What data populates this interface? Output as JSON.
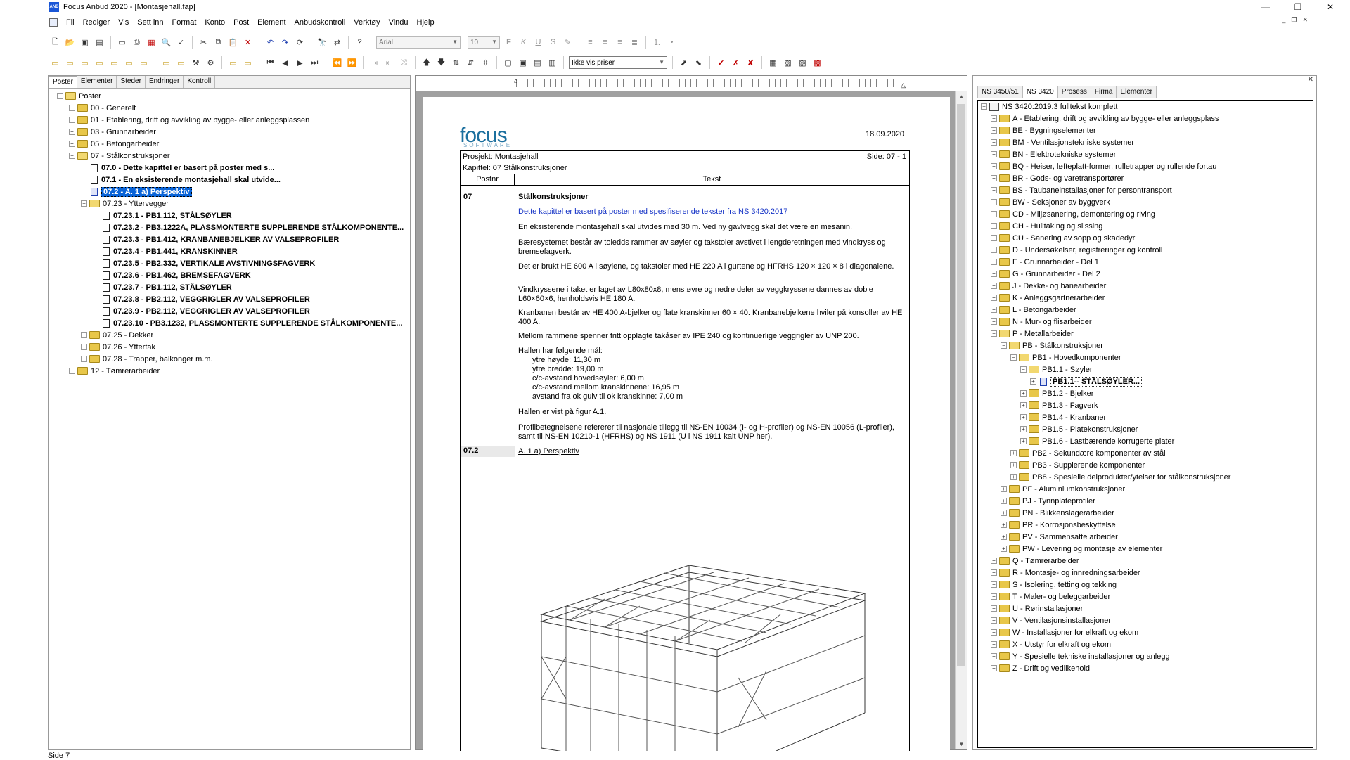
{
  "window": {
    "title": "Focus Anbud 2020 - [Montasjehall.fap]",
    "app_icon": "ANB"
  },
  "window_controls": [
    "minimize-icon",
    "restore-icon",
    "close-icon"
  ],
  "menu": [
    "Fil",
    "Rediger",
    "Vis",
    "Sett inn",
    "Format",
    "Konto",
    "Post",
    "Element",
    "Anbudskontroll",
    "Verktøy",
    "Vindu",
    "Hjelp"
  ],
  "toolbar": {
    "font": "Arial",
    "size": "10",
    "price_option": "Ikke vis priser"
  },
  "left_panel": {
    "tabs": [
      "Poster",
      "Elementer",
      "Steder",
      "Endringer",
      "Kontroll"
    ],
    "root": "Poster",
    "items": [
      {
        "label": "00 - Generelt",
        "level": 1,
        "type": "folder",
        "exp": "+"
      },
      {
        "label": "01 - Etablering, drift og avvikling av bygge- eller anleggsplassen",
        "level": 1,
        "type": "folder",
        "exp": "+"
      },
      {
        "label": "03 - Grunnarbeider",
        "level": 1,
        "type": "folder",
        "exp": "+"
      },
      {
        "label": "05 - Betongarbeider",
        "level": 1,
        "type": "folder",
        "exp": "+"
      },
      {
        "label": "07 - Stålkonstruksjoner",
        "level": 1,
        "type": "folder-open",
        "exp": "-"
      },
      {
        "label": "07.0 - Dette kapittel er basert på poster med s...",
        "level": 2,
        "type": "doc",
        "bold": true
      },
      {
        "label": "07.1 - En eksisterende montasjehall skal utvide...",
        "level": 2,
        "type": "doc",
        "bold": true
      },
      {
        "label": "07.2 - A. 1 a) Perspektiv",
        "level": 2,
        "type": "doc-blue",
        "bold": true,
        "selected": true
      },
      {
        "label": "07.23 - Yttervegger",
        "level": 2,
        "type": "folder-open",
        "exp": "-"
      },
      {
        "label": "07.23.1 - PB1.112, STÅLSØYLER",
        "level": 3,
        "type": "doc",
        "bold": true
      },
      {
        "label": "07.23.2 - PB3.1222A, PLASSMONTERTE SUPPLERENDE STÅLKOMPONENTE...",
        "level": 3,
        "type": "doc",
        "bold": true
      },
      {
        "label": "07.23.3 - PB1.412, KRANBANEBJELKER AV VALSEPROFILER",
        "level": 3,
        "type": "doc",
        "bold": true
      },
      {
        "label": "07.23.4 - PB1.441, KRANSKINNER",
        "level": 3,
        "type": "doc",
        "bold": true
      },
      {
        "label": "07.23.5 - PB2.332, VERTIKALE AVSTIVNINGSFAGVERK",
        "level": 3,
        "type": "doc",
        "bold": true
      },
      {
        "label": "07.23.6 - PB1.462, BREMSEFAGVERK",
        "level": 3,
        "type": "doc",
        "bold": true
      },
      {
        "label": "07.23.7 - PB1.112, STÅLSØYLER",
        "level": 3,
        "type": "doc",
        "bold": true
      },
      {
        "label": "07.23.8 - PB2.112, VEGGRIGLER AV VALSEPROFILER",
        "level": 3,
        "type": "doc",
        "bold": true
      },
      {
        "label": "07.23.9 - PB2.112, VEGGRIGLER AV VALSEPROFILER",
        "level": 3,
        "type": "doc",
        "bold": true
      },
      {
        "label": "07.23.10 - PB3.1232, PLASSMONTERTE SUPPLERENDE STÅLKOMPONENTE...",
        "level": 3,
        "type": "doc",
        "bold": true
      },
      {
        "label": "07.25 - Dekker",
        "level": 2,
        "type": "folder",
        "exp": "+"
      },
      {
        "label": "07.26 - Yttertak",
        "level": 2,
        "type": "folder",
        "exp": "+"
      },
      {
        "label": "07.28 - Trapper, balkonger m.m.",
        "level": 2,
        "type": "folder",
        "exp": "+"
      },
      {
        "label": "12 - Tømrerarbeider",
        "level": 1,
        "type": "folder",
        "exp": "+"
      }
    ]
  },
  "document": {
    "logo": "focus",
    "logo_sub": "SOFTWARE",
    "date": "18.09.2020",
    "project_label": "Prosjekt:  Montasjehall",
    "chapter_label": "Kapittel:  07 Stålkonstruksjoner",
    "page_label": "Side:  07 - 1",
    "col_postnr": "Postnr",
    "col_tekst": "Tekst",
    "post1": "07",
    "title1": "Stålkonstruksjoner",
    "blue_text": "Dette kapittel er basert på poster med spesifiserende tekster fra NS 3420:2017",
    "p1": "En eksisterende montasjehall skal utvides med 30 m. Ved ny gavlvegg skal det være en mesanin.",
    "p2": "Bæresystemet består av toledds rammer av søyler og takstoler avstivet i lengderetningen med vindkryss og bremsefagverk.",
    "p3": "Det er brukt HE 600 A i søylene, og takstoler med HE 220 A i gurtene og HFRHS 120 × 120 × 8 i diagonalene.",
    "p4": "Vindkryssene i taket er laget av L80x80x8, mens øvre og nedre deler av veggkryssene dannes av doble L60×60×6, henholdsvis HE 180 A.",
    "p5": "Kranbanen består av HE 400 A-bjelker og flate kranskinner 60 × 40. Kranbanebjelkene hviler på konsoller av HE 400 A.",
    "p6": "Mellom rammene spenner fritt opplagte takåser av IPE 240 og kontinuerlige veggrigler av UNP 200.",
    "p7": "Hallen har følgende mål:",
    "dims": [
      "ytre høyde: 11,30 m",
      "ytre bredde: 19,00 m",
      "c/c-avstand hovedsøyler: 6,00 m",
      "c/c-avstand mellom kranskinnene: 16,95 m",
      "avstand fra ok gulv til ok kranskinne: 7,00 m"
    ],
    "p8": "Hallen er vist på figur A.1.",
    "p9": "Profilbetegnelsene refererer til nasjonale tillegg til NS-EN 10034 (I- og H-profiler) og NS-EN 10056 (L-profiler), samt til NS-EN 10210-1 (HFRHS) og NS 1911 (U i NS 1911 kalt UNP her).",
    "post2": "07.2",
    "title2": "A. 1 a) Perspektiv"
  },
  "right_panel": {
    "tabs": [
      "NS 3450/51",
      "NS 3420",
      "Prosess",
      "Firma",
      "Elementer"
    ],
    "root": "NS 3420:2019.3 fulltekst komplett",
    "items": [
      {
        "label": "A - Etablering, drift og avvikling av bygge- eller anleggsplass",
        "level": 1,
        "exp": "+"
      },
      {
        "label": "BE - Bygningselementer",
        "level": 1,
        "exp": "+"
      },
      {
        "label": "BM - Ventilasjonstekniske systemer",
        "level": 1,
        "exp": "+"
      },
      {
        "label": "BN - Elektrotekniske systemer",
        "level": 1,
        "exp": "+"
      },
      {
        "label": "BQ - Heiser, løfteplatt-former, rulletrapper og rullende fortau",
        "level": 1,
        "exp": "+"
      },
      {
        "label": "BR - Gods- og varetransportører",
        "level": 1,
        "exp": "+"
      },
      {
        "label": "BS - Taubaneinstallasjoner for persontransport",
        "level": 1,
        "exp": "+"
      },
      {
        "label": "BW - Seksjoner av byggverk",
        "level": 1,
        "exp": "+"
      },
      {
        "label": "CD - Miljøsanering, demontering og riving",
        "level": 1,
        "exp": "+"
      },
      {
        "label": "CH - Hulltaking og slissing",
        "level": 1,
        "exp": "+"
      },
      {
        "label": "CU - Sanering av sopp og skadedyr",
        "level": 1,
        "exp": "+"
      },
      {
        "label": "D - Undersøkelser, registreringer og kontroll",
        "level": 1,
        "exp": "+"
      },
      {
        "label": "F - Grunnarbeider - Del 1",
        "level": 1,
        "exp": "+"
      },
      {
        "label": "G - Grunnarbeider - Del 2",
        "level": 1,
        "exp": "+"
      },
      {
        "label": "J - Dekke- og banearbeider",
        "level": 1,
        "exp": "+"
      },
      {
        "label": "K - Anleggsgartnerarbeider",
        "level": 1,
        "exp": "+"
      },
      {
        "label": "L - Betongarbeider",
        "level": 1,
        "exp": "+"
      },
      {
        "label": "N - Mur- og flisarbeider",
        "level": 1,
        "exp": "+"
      },
      {
        "label": "P - Metallarbeider",
        "level": 1,
        "exp": "-"
      },
      {
        "label": "PB - Stålkonstruksjoner",
        "level": 2,
        "exp": "-"
      },
      {
        "label": "PB1 - Hovedkomponenter",
        "level": 3,
        "exp": "-"
      },
      {
        "label": "PB1.1 - Søyler",
        "level": 4,
        "exp": "-"
      },
      {
        "label": "PB1.1-- STÅLSØYLER...",
        "level": 5,
        "exp": "+",
        "doc": true,
        "highlight": true
      },
      {
        "label": "PB1.2 - Bjelker",
        "level": 4,
        "exp": "+"
      },
      {
        "label": "PB1.3 - Fagverk",
        "level": 4,
        "exp": "+"
      },
      {
        "label": "PB1.4 - Kranbaner",
        "level": 4,
        "exp": "+"
      },
      {
        "label": "PB1.5 - Platekonstruksjoner",
        "level": 4,
        "exp": "+"
      },
      {
        "label": "PB1.6 - Lastbærende korrugerte plater",
        "level": 4,
        "exp": "+"
      },
      {
        "label": "PB2 - Sekundære komponenter av stål",
        "level": 3,
        "exp": "+"
      },
      {
        "label": "PB3 - Supplerende komponenter",
        "level": 3,
        "exp": "+"
      },
      {
        "label": "PB8 - Spesielle delprodukter/ytelser for stålkonstruksjoner",
        "level": 3,
        "exp": "+"
      },
      {
        "label": "PF - Aluminiumkonstruksjoner",
        "level": 2,
        "exp": "+"
      },
      {
        "label": "PJ - Tynnplateprofiler",
        "level": 2,
        "exp": "+"
      },
      {
        "label": "PN - Blikkenslagerarbeider",
        "level": 2,
        "exp": "+"
      },
      {
        "label": "PR - Korrosjonsbeskyttelse",
        "level": 2,
        "exp": "+"
      },
      {
        "label": "PV - Sammensatte arbeider",
        "level": 2,
        "exp": "+"
      },
      {
        "label": "PW - Levering og montasje av elementer",
        "level": 2,
        "exp": "+"
      },
      {
        "label": "Q - Tømrerarbeider",
        "level": 1,
        "exp": "+"
      },
      {
        "label": "R - Montasje- og innredningsarbeider",
        "level": 1,
        "exp": "+"
      },
      {
        "label": "S - Isolering, tetting og tekking",
        "level": 1,
        "exp": "+"
      },
      {
        "label": "T - Maler- og beleggarbeider",
        "level": 1,
        "exp": "+"
      },
      {
        "label": "U - Rørinstallasjoner",
        "level": 1,
        "exp": "+"
      },
      {
        "label": "V - Ventilasjonsinstallasjoner",
        "level": 1,
        "exp": "+"
      },
      {
        "label": "W - Installasjoner for elkraft og ekom",
        "level": 1,
        "exp": "+"
      },
      {
        "label": "X - Utstyr for elkraft og ekom",
        "level": 1,
        "exp": "+"
      },
      {
        "label": "Y - Spesielle tekniske installasjoner og anlegg",
        "level": 1,
        "exp": "+"
      },
      {
        "label": "Z - Drift og vedlikehold",
        "level": 1,
        "exp": "+"
      }
    ]
  },
  "status": "Side 7"
}
